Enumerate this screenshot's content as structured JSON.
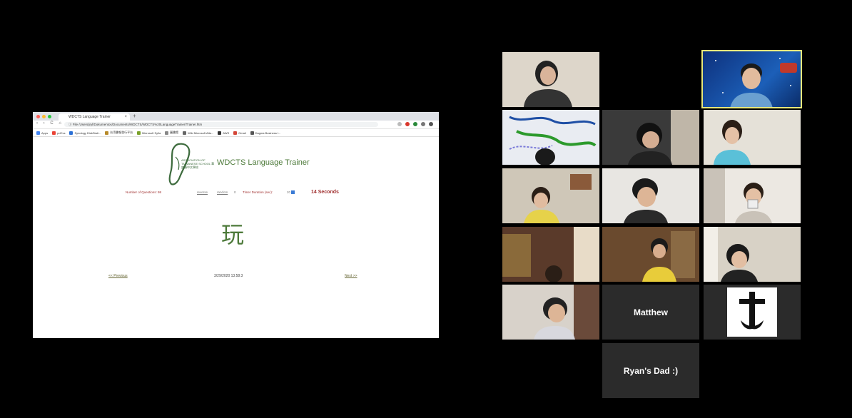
{
  "browser": {
    "tab_title": "WDCTS Language Trainer",
    "new_tab_symbol": "+",
    "close_symbol": "×",
    "nav_symbols": "‹ › C ⌂",
    "address": "ⓘ File  /Users/jryl/Dokumentos/Documents/WDCTS/WDCTS%20LanguageTrainer/Trainer.htm",
    "bookmarks": [
      {
        "label": "Apps",
        "color": "#4285f4"
      },
      {
        "label": "pdCvs",
        "color": "#ea4335"
      },
      {
        "label": "Synology DiskStati...",
        "color": "#2a6fd6"
      },
      {
        "label": "台湾書報發行平台",
        "color": "#b78a2a"
      },
      {
        "label": "Microsoft Sylla",
        "color": "#7aa12a"
      },
      {
        "label": "圖書館",
        "color": "#888888"
      },
      {
        "label": "Wiki Microsoft Atla...",
        "color": "#666666"
      },
      {
        "label": "AWS",
        "color": "#333333"
      },
      {
        "label": "Gmail",
        "color": "#d44638"
      },
      {
        "label": "Dagma Business I...",
        "color": "#555555"
      }
    ]
  },
  "trainer": {
    "logo_text": "ASSOCIATION OF TAIWANESE SCHOOL 華盛頓中文學校",
    "title": "WDCTS Language Trainer",
    "num_questions_label": "Number of Questions: 98",
    "option_a": "reverse",
    "option_b": "random",
    "option_b_value": "0",
    "timer_label": "Timer Duration (sec):",
    "timer_value": "20",
    "countdown": "14 Seconds",
    "character": "玩",
    "previous_link": "<< Previous",
    "timestamp": "3/29/2020 13:58:3",
    "next_link": "Next >>"
  },
  "participants": {
    "matthew_name": "Matthew",
    "ryans_dad_name": "Ryan's Dad :)"
  },
  "colors": {
    "highlight_border": "#e8e87a",
    "brand_green": "#4d7a3a",
    "label_red": "#a03030"
  }
}
